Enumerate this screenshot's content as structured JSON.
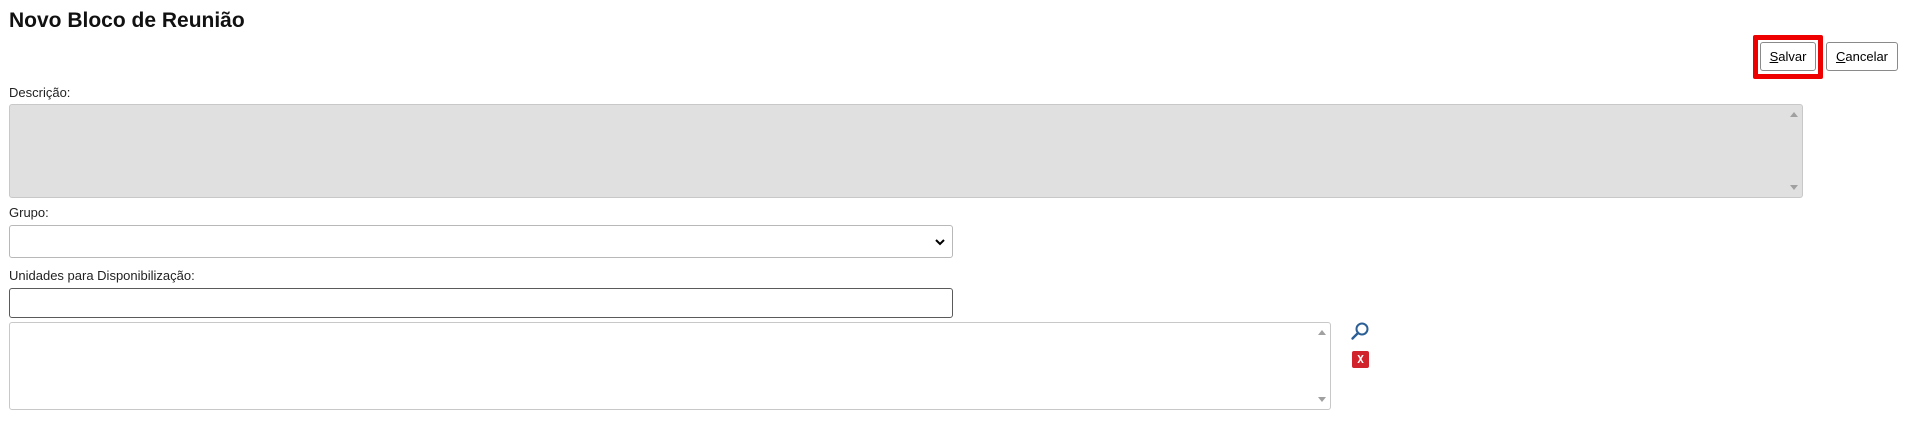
{
  "page": {
    "title": "Novo Bloco de Reunião"
  },
  "toolbar": {
    "save_label_access": "S",
    "save_label_rest": "alvar",
    "cancel_label_access": "C",
    "cancel_label_rest": "ancelar",
    "highlight_color": "#ee0000"
  },
  "form": {
    "descricao_label": "Descrição:",
    "descricao_value": "",
    "grupo_label": "Grupo:",
    "grupo_selected": "",
    "unidades_label": "Unidades para Disponibilização:",
    "unidades_input_value": "",
    "unidades_list": []
  },
  "icons": {
    "search": "magnifier-icon",
    "remove": "remove-x-icon",
    "remove_glyph": "X",
    "remove_color": "#d0232b",
    "search_color": "#2b5f96"
  }
}
